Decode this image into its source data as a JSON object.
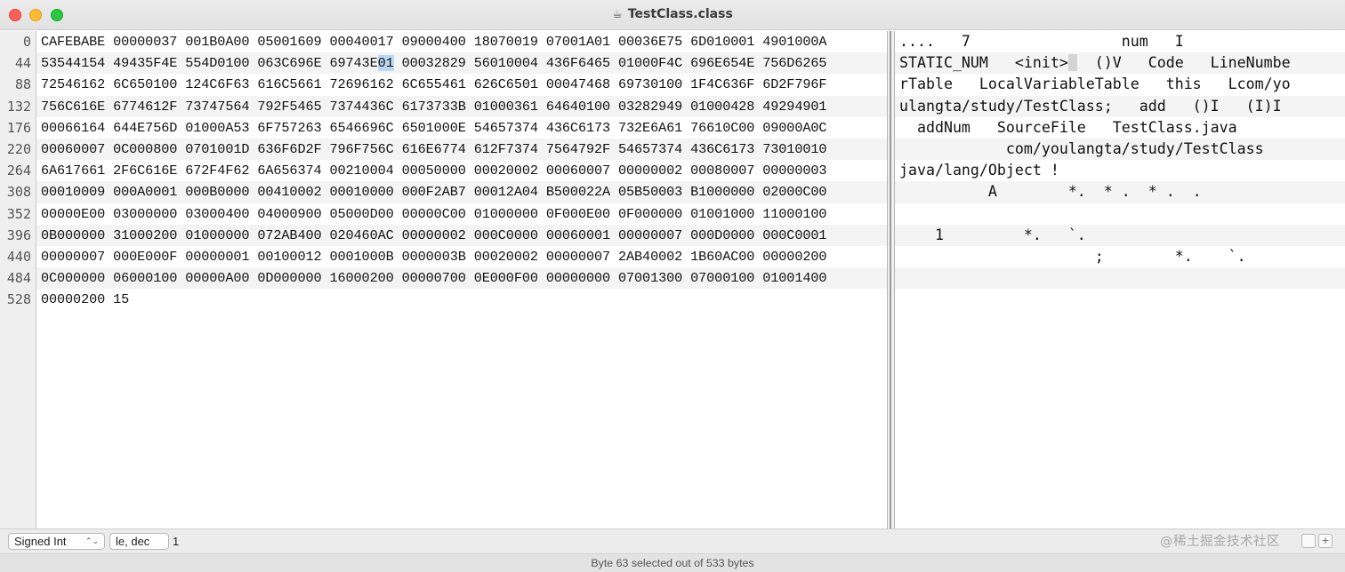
{
  "window": {
    "title": "TestClass.class",
    "title_icon": "coffee-cup-icon"
  },
  "gutter": [
    "0",
    "44",
    "88",
    "132",
    "176",
    "220",
    "264",
    "308",
    "352",
    "396",
    "440",
    "484",
    "528"
  ],
  "hex_rows": [
    {
      "pre": "CAFEBABE 00000037 001B0A00 05001609 00040017 09000400 18070019 07001A01 00036E75 6D010001 4901000A",
      "sel": "",
      "post": ""
    },
    {
      "pre": "53544154 49435F4E 554D0100 063C696E 69743E",
      "sel": "01",
      "post": " 00032829 56010004 436F6465 01000F4C 696E654E 756D6265"
    },
    {
      "pre": "72546162 6C650100 124C6F63 616C5661 72696162 6C655461 626C6501 00047468 69730100 1F4C636F 6D2F796F",
      "sel": "",
      "post": ""
    },
    {
      "pre": "756C616E 6774612F 73747564 792F5465 7374436C 6173733B 01000361 64640100 03282949 01000428 49294901",
      "sel": "",
      "post": ""
    },
    {
      "pre": "00066164 644E756D 01000A53 6F757263 6546696C 6501000E 54657374 436C6173 732E6A61 76610C00 09000A0C",
      "sel": "",
      "post": ""
    },
    {
      "pre": "00060007 0C000800 0701001D 636F6D2F 796F756C 616E6774 612F7374 7564792F 54657374 436C6173 73010010",
      "sel": "",
      "post": ""
    },
    {
      "pre": "6A617661 2F6C616E 672F4F62 6A656374 00210004 00050000 00020002 00060007 00000002 00080007 00000003",
      "sel": "",
      "post": ""
    },
    {
      "pre": "00010009 000A0001 000B0000 00410002 00010000 000F2AB7 00012A04 B500022A 05B50003 B1000000 02000C00",
      "sel": "",
      "post": ""
    },
    {
      "pre": "00000E00 03000000 03000400 04000900 05000D00 00000C00 01000000 0F000E00 0F000000 01001000 11000100",
      "sel": "",
      "post": ""
    },
    {
      "pre": "0B000000 31000200 01000000 072AB400 020460AC 00000002 000C0000 00060001 00000007 000D0000 000C0001",
      "sel": "",
      "post": ""
    },
    {
      "pre": "00000007 000E000F 00000001 00100012 0001000B 0000003B 00020002 00000007 2AB40002 1B60AC00 00000200",
      "sel": "",
      "post": ""
    },
    {
      "pre": "0C000000 06000100 00000A00 0D000000 16000200 00000700 0E000F00 00000000 07001300 07000100 01001400",
      "sel": "",
      "post": ""
    },
    {
      "pre": "00000200 15",
      "sel": "",
      "post": ""
    }
  ],
  "text_rows": [
    {
      "pre": "....   7                 num   I",
      "sel": "",
      "post": ""
    },
    {
      "pre": "STATIC_NUM   <init>",
      "sel": " ",
      "post": "  ()V   Code   LineNumbe"
    },
    {
      "pre": "rTable   LocalVariableTable   this   Lcom/yo",
      "sel": "",
      "post": ""
    },
    {
      "pre": "ulangta/study/TestClass;   add   ()I   (I)I",
      "sel": "",
      "post": ""
    },
    {
      "pre": "  addNum   SourceFile   TestClass.java",
      "sel": "",
      "post": ""
    },
    {
      "pre": "            com/youlangta/study/TestClass",
      "sel": "",
      "post": ""
    },
    {
      "pre": "java/lang/Object !",
      "sel": "",
      "post": ""
    },
    {
      "pre": "          A        *.  * .  * .  .",
      "sel": "",
      "post": ""
    },
    {
      "pre": "",
      "sel": "",
      "post": ""
    },
    {
      "pre": "    1         *.   `.",
      "sel": "",
      "post": ""
    },
    {
      "pre": "                      ;        *.    `.",
      "sel": "",
      "post": ""
    },
    {
      "pre": "",
      "sel": "",
      "post": ""
    },
    {
      "pre": "",
      "sel": "",
      "post": ""
    }
  ],
  "bottom": {
    "type_select": "Signed Int",
    "endian_select": "le, dec",
    "value": "1",
    "watermark": "@稀土掘金技术社区"
  },
  "status": "Byte 63 selected out of 533 bytes"
}
